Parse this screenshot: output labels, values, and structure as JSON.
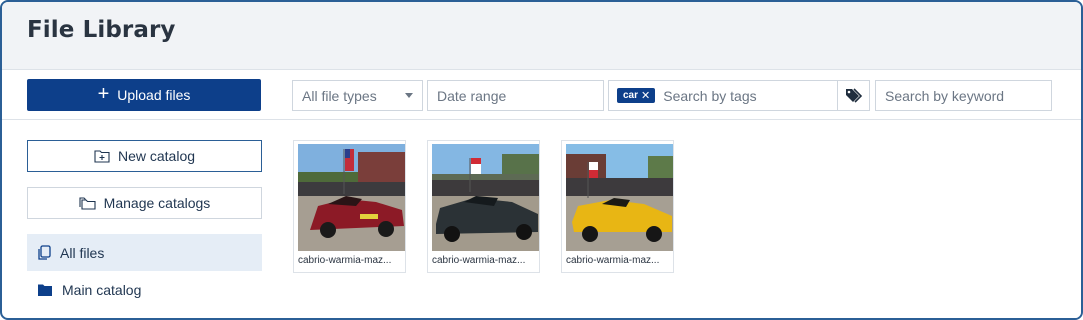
{
  "header": {
    "title": "File Library"
  },
  "toolbar": {
    "upload_label": "Upload files",
    "file_type_selected": "All file types",
    "date_range_placeholder": "Date range",
    "tag_chip": "car",
    "tags_placeholder": "Search by tags",
    "keyword_placeholder": "Search by keyword"
  },
  "sidebar": {
    "new_catalog_label": "New catalog",
    "manage_catalogs_label": "Manage catalogs",
    "items": [
      {
        "label": "All files",
        "icon": "copy-icon",
        "active": true
      },
      {
        "label": "Main catalog",
        "icon": "folder-icon",
        "active": false
      }
    ]
  },
  "files": [
    {
      "name": "cabrio-warmia-maz...",
      "car_color": "#8c1a26"
    },
    {
      "name": "cabrio-warmia-maz...",
      "car_color": "#2b3236"
    },
    {
      "name": "cabrio-warmia-maz...",
      "car_color": "#e8b614"
    }
  ],
  "colors": {
    "accent": "#0d3f8a",
    "border": "#2b5f96",
    "active_bg": "#e5edf6"
  }
}
